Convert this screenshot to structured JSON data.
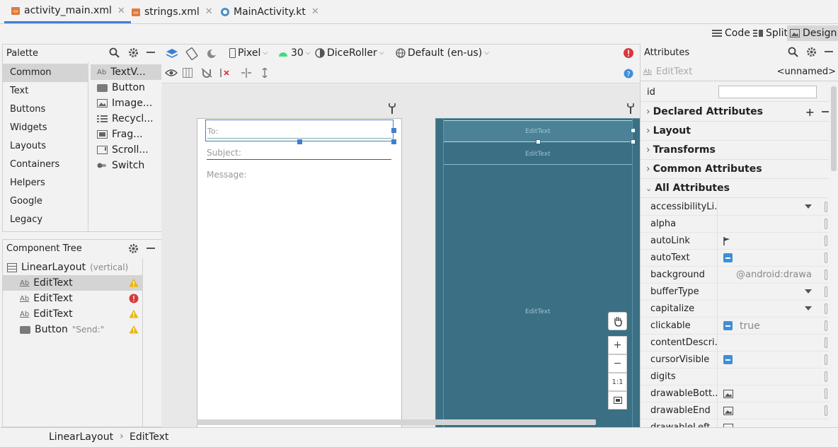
{
  "tabs": [
    {
      "label": "activity_main.xml",
      "close": "✕"
    },
    {
      "label": "strings.xml",
      "close": "✕"
    },
    {
      "label": "MainActivity.kt",
      "close": "✕"
    }
  ],
  "view_modes": {
    "code": "Code",
    "split": "Split",
    "design": "Design"
  },
  "palette": {
    "title": "Palette",
    "categories": [
      "Common",
      "Text",
      "Buttons",
      "Widgets",
      "Layouts",
      "Containers",
      "Helpers",
      "Google",
      "Legacy"
    ],
    "items": [
      "TextV...",
      "Button",
      "Image...",
      "Recycl...",
      "Frag...",
      "Scroll...",
      "Switch"
    ]
  },
  "component_tree": {
    "title": "Component Tree",
    "root_label": "LinearLayout",
    "root_hint": "(vertical)",
    "children": [
      {
        "label": "EditText",
        "hint": "",
        "status": "warning"
      },
      {
        "label": "EditText",
        "hint": "",
        "status": "error"
      },
      {
        "label": "EditText",
        "hint": "",
        "status": "warning"
      },
      {
        "label": "Button",
        "hint": "\"Send:\"",
        "status": "warning"
      }
    ]
  },
  "design_toolbar": {
    "device": "Pixel",
    "api": "30",
    "theme": "DiceRoller",
    "locale": "Default (en-us)"
  },
  "design_view": {
    "to_hint": "To:",
    "subject_hint": "Subject:",
    "message_hint": "Message:"
  },
  "blueprint": {
    "field1": "EditText",
    "field2": "EditText",
    "field3": "EditText"
  },
  "zoom": {
    "one_to_one": "1:1",
    "plus": "+",
    "minus": "−"
  },
  "attributes": {
    "title": "Attributes",
    "widget": "EditText",
    "widget_name": "<unnamed>",
    "id_label": "id",
    "sections": [
      "Declared Attributes",
      "Layout",
      "Transforms",
      "Common Attributes",
      "All Attributes"
    ],
    "all_attributes": [
      {
        "name": "accessibilityLi...",
        "value": "",
        "kind": "dropdown"
      },
      {
        "name": "alpha",
        "value": "",
        "kind": "text"
      },
      {
        "name": "autoLink",
        "value": "",
        "kind": "flag"
      },
      {
        "name": "autoText",
        "value": "",
        "kind": "bool"
      },
      {
        "name": "background",
        "value": "@android:drawa",
        "kind": "text"
      },
      {
        "name": "bufferType",
        "value": "",
        "kind": "dropdown"
      },
      {
        "name": "capitalize",
        "value": "",
        "kind": "dropdown"
      },
      {
        "name": "clickable",
        "value": "true",
        "kind": "bool"
      },
      {
        "name": "contentDescri...",
        "value": "",
        "kind": "text"
      },
      {
        "name": "cursorVisible",
        "value": "",
        "kind": "bool"
      },
      {
        "name": "digits",
        "value": "",
        "kind": "text"
      },
      {
        "name": "drawableBott...",
        "value": "",
        "kind": "image"
      },
      {
        "name": "drawableEnd",
        "value": "",
        "kind": "image"
      },
      {
        "name": "drawableLeft",
        "value": "",
        "kind": "image"
      }
    ]
  },
  "breadcrumb": [
    "LinearLayout",
    "EditText"
  ],
  "breadcrumb_sep": "›",
  "colors": {
    "accent": "#3d7fd1",
    "blueprint": "#3b6f83",
    "warning": "#f0b400",
    "error": "#d9383a"
  }
}
